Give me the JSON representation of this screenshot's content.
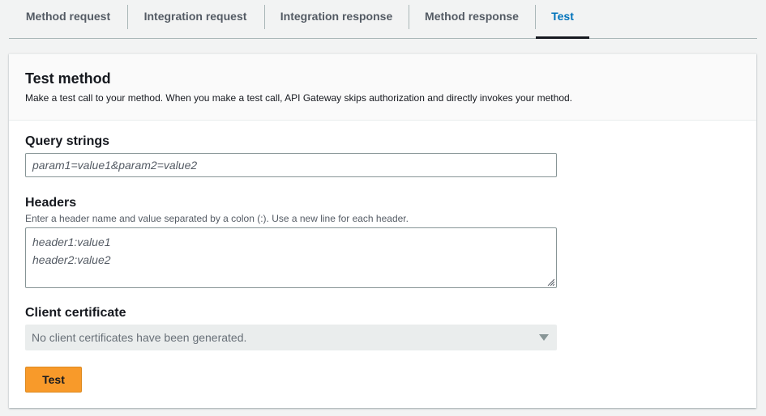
{
  "tabs": [
    {
      "label": "Method request",
      "active": false
    },
    {
      "label": "Integration request",
      "active": false
    },
    {
      "label": "Integration response",
      "active": false
    },
    {
      "label": "Method response",
      "active": false
    },
    {
      "label": "Test",
      "active": true
    }
  ],
  "test_method": {
    "title": "Test method",
    "description": "Make a test call to your method. When you make a test call, API Gateway skips authorization and directly invokes your method."
  },
  "query_strings": {
    "label": "Query strings",
    "value": "param1=value1&param2=value2"
  },
  "headers": {
    "label": "Headers",
    "hint": "Enter a header name and value separated by a colon (:). Use a new line for each header.",
    "lines": [
      "header1:value1",
      "header2:value2"
    ]
  },
  "client_certificate": {
    "label": "Client certificate",
    "selected": "No client certificates have been generated."
  },
  "test_button_label": "Test",
  "colors": {
    "accent": "#0073bb",
    "primary_button": "#f89a2a"
  }
}
